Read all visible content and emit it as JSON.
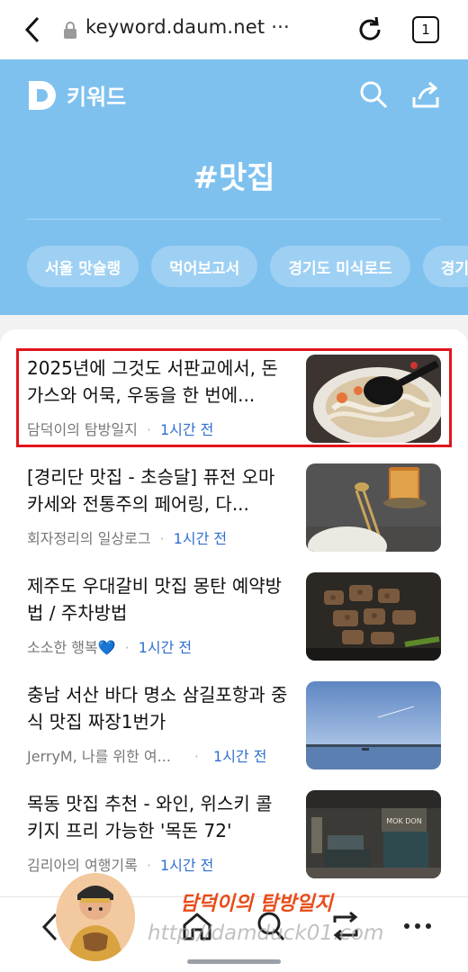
{
  "browser": {
    "url": "keyword.daum.net ···",
    "tab_count": "1"
  },
  "header": {
    "logo_letter": "D",
    "brand": "키워드",
    "keyword": "#맛집",
    "chips": [
      "서울 맛슐랭",
      "먹어보고서",
      "경기도 미식로드",
      "경기"
    ],
    "accent_color": "#7ec1ef"
  },
  "articles": [
    {
      "title": "2025년에 그것도 서판교에서, 돈가스와 어묵, 우동을 한 번에...",
      "source": "담덕이의 탐방일지",
      "time": "1시간 전"
    },
    {
      "title": "[경리단 맛집 - 초승달] 퓨전 오마카세와 전통주의 페어링, 다...",
      "source": "회자정리의 일상로그",
      "time": "1시간 전"
    },
    {
      "title": "제주도 우대갈비 맛집 몽탄 예약방법 / 주차방법",
      "source": "소소한 행복💙",
      "time": "1시간 전"
    },
    {
      "title": "충남 서산 바다 명소 삼길포항과 중식 맛집 짜장1번가",
      "source": "JerryM, 나를 위한 여...",
      "time": "1시간 전"
    },
    {
      "title": "목동 맛집 추천 - 와인, 위스키 콜키지 프리 가능한 '목돈 72'",
      "source": "김리아의 여행기록",
      "time": "1시간 전"
    }
  ],
  "thumbnail_labels": {
    "item5_sign": "MOK DON"
  },
  "watermark": {
    "name": "담덕이의 탐방일지",
    "url": "http://damduck01.com"
  }
}
